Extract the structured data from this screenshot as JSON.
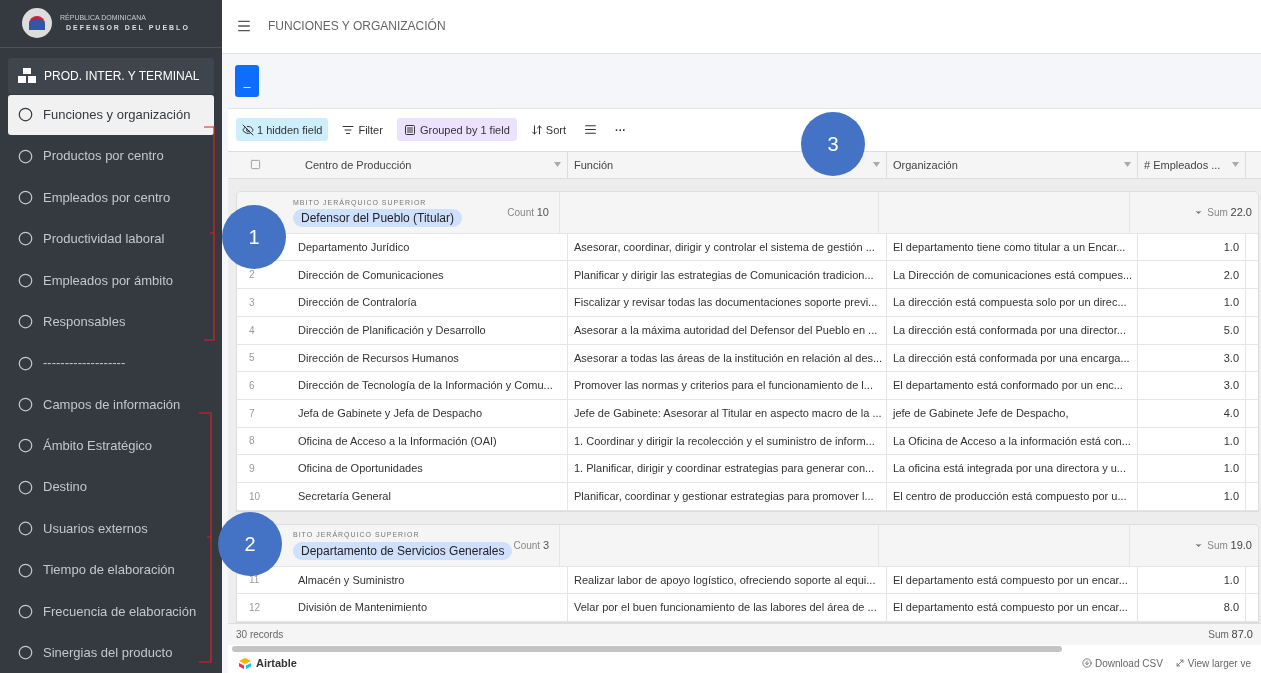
{
  "brand": {
    "country": "RÉPUBLICA DOMINICANA",
    "name": "DEFENSOR DEL PUEBLO"
  },
  "sidebar": {
    "section": "PROD. INTER. Y TERMINAL",
    "items": [
      {
        "label": "Funciones y organización",
        "selected": true
      },
      {
        "label": "Productos por centro",
        "selected": false
      },
      {
        "label": "Empleados por centro",
        "selected": false
      },
      {
        "label": "Productividad laboral",
        "selected": false
      },
      {
        "label": "Empleados por ámbito",
        "selected": false
      },
      {
        "label": "Responsables",
        "selected": false
      },
      {
        "label": "-------------------",
        "selected": false
      },
      {
        "label": "Campos de información",
        "selected": false
      },
      {
        "label": "Ámbito Estratégico",
        "selected": false
      },
      {
        "label": "Destino",
        "selected": false
      },
      {
        "label": "Usuarios externos",
        "selected": false
      },
      {
        "label": "Tiempo de elaboración",
        "selected": false
      },
      {
        "label": "Frecuencia de elaboración",
        "selected": false
      },
      {
        "label": "Sinergias del producto",
        "selected": false
      }
    ]
  },
  "header": {
    "title": "FUNCIONES Y ORGANIZACIÓN"
  },
  "action_button": {
    "label": "_"
  },
  "toolbar": {
    "hidden": "1 hidden field",
    "filter": "Filter",
    "grouped": "Grouped by 1 field",
    "sort": "Sort",
    "more": "···"
  },
  "table": {
    "select_all": {
      "checked": false
    },
    "columns": [
      "Centro de Producción",
      "Función",
      "Organización",
      "# Empleados ..."
    ],
    "groups": [
      {
        "field": "MBITO JERÁRQUICO SUPERIOR",
        "value": "Defensor del Pueblo (Titular)",
        "count_label": "Count",
        "count": "10",
        "sum_label": "Sum",
        "sum": "22.0",
        "rows": [
          {
            "num": "",
            "cells": [
              "Departamento Jurídico",
              "Asesorar, coordinar, dirigir y controlar el sistema de gestión ...",
              "El departamento tiene como titular a un Encar...",
              "1.0"
            ]
          },
          {
            "num": "2",
            "cells": [
              "Dirección de Comunicaciones",
              "Planificar y dirigir las estrategias de Comunicación tradicion...",
              "La Dirección de comunicaciones está compues...",
              "2.0"
            ]
          },
          {
            "num": "3",
            "cells": [
              "Dirección de Contraloría",
              "Fiscalizar y revisar todas las documentaciones soporte previ...",
              "La dirección está compuesta solo por un direc...",
              "1.0"
            ]
          },
          {
            "num": "4",
            "cells": [
              "Dirección de Planificación y Desarrollo",
              "Asesorar a la máxima autoridad del Defensor del Pueblo en ...",
              "La dirección está conformada por una director...",
              "5.0"
            ]
          },
          {
            "num": "5",
            "cells": [
              "Dirección de Recursos Humanos",
              "Asesorar a todas las áreas de la institución en relación al des...",
              "La dirección está conformada por una encarga...",
              "3.0"
            ]
          },
          {
            "num": "6",
            "cells": [
              "Dirección de Tecnología de la Información y Comu...",
              "Promover las normas y criterios para el funcionamiento de l...",
              "El departamento está conformado por un enc...",
              "3.0"
            ]
          },
          {
            "num": "7",
            "cells": [
              "Jefa de Gabinete y Jefa de Despacho",
              "Jefe de Gabinete: Asesorar al Titular en aspecto macro de la ...",
              "jefe de Gabinete Jefe de Despacho,",
              "4.0"
            ]
          },
          {
            "num": "8",
            "cells": [
              "Oficina de Acceso a la Información (OAI)",
              "1. Coordinar y dirigir la recolección y el suministro de inform...",
              "La Oficina de Acceso a la información está con...",
              "1.0"
            ]
          },
          {
            "num": "9",
            "cells": [
              "Oficina de Oportunidades",
              "1. Planificar, dirigir y coordinar estrategias para generar con...",
              "La oficina está integrada por una directora y u...",
              "1.0"
            ]
          },
          {
            "num": "10",
            "cells": [
              "Secretaría General",
              "Planificar, coordinar y gestionar estrategias para promover l...",
              "El centro de producción está compuesto por u...",
              "1.0"
            ]
          }
        ]
      },
      {
        "field": "BITO JERÁRQUICO SUPERIOR",
        "value": "Departamento de Servicios Generales",
        "count_label": "Count",
        "count": "3",
        "sum_label": "Sum",
        "sum": "19.0",
        "rows": [
          {
            "num": "11",
            "cells": [
              "Almacén y Suministro",
              "Realizar labor de apoyo logístico, ofreciendo soporte al equi...",
              "El departamento está compuesto por un encar...",
              "1.0"
            ]
          },
          {
            "num": "12",
            "cells": [
              "División de Mantenimiento",
              "Velar por el buen funcionamiento de las labores del área de ...",
              "El departamento está compuesto por un encar...",
              "8.0"
            ]
          }
        ]
      }
    ],
    "records": "30 records",
    "total_label": "Sum",
    "total": "87.0"
  },
  "footer": {
    "brand": "Airtable",
    "download": "Download CSV",
    "view": "View larger ve"
  },
  "callouts": [
    "1",
    "2",
    "3"
  ]
}
